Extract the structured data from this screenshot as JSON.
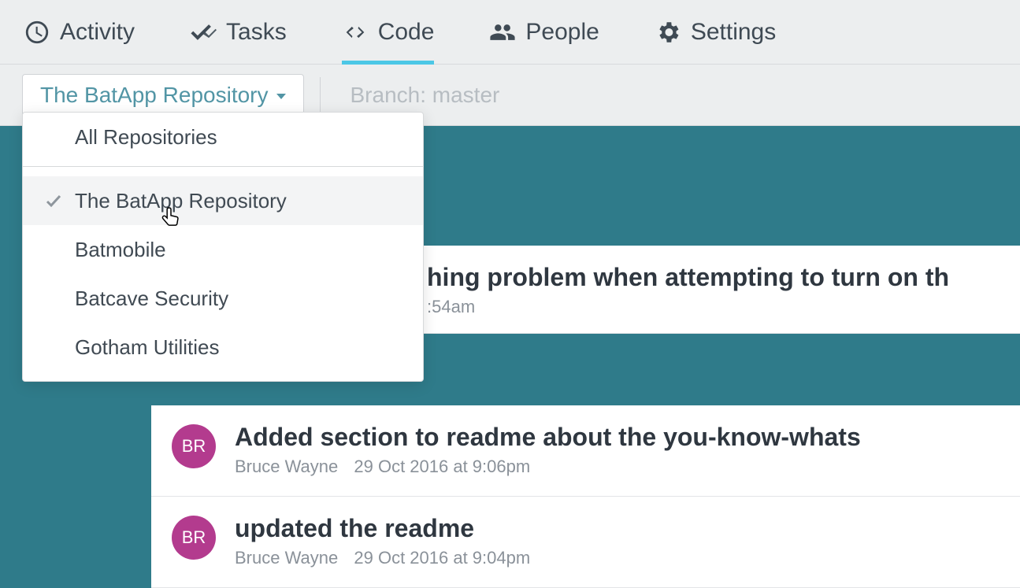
{
  "nav": {
    "activity": "Activity",
    "tasks": "Tasks",
    "code": "Code",
    "people": "People",
    "settings": "Settings",
    "active": "code"
  },
  "filters": {
    "repo_selected": "The BatApp Repository",
    "branch_label": "Branch: master"
  },
  "repo_dropdown": {
    "all_label": "All Repositories",
    "items": [
      {
        "label": "The BatApp Repository",
        "selected": true
      },
      {
        "label": "Batmobile",
        "selected": false
      },
      {
        "label": "Batcave Security",
        "selected": false
      },
      {
        "label": "Gotham Utilities",
        "selected": false
      }
    ]
  },
  "commits": [
    {
      "initials": "",
      "title_fragment": "hing problem when attempting to turn on th",
      "time_fragment": ":54am",
      "author": "",
      "timestamp": ""
    },
    {
      "initials": "BR",
      "title": "Added section to readme about the you-know-whats",
      "author": "Bruce Wayne",
      "timestamp": "29 Oct 2016 at 9:06pm"
    },
    {
      "initials": "BR",
      "title": "updated the readme",
      "author": "Bruce Wayne",
      "timestamp": "29 Oct 2016 at 9:04pm"
    }
  ],
  "colors": {
    "accent": "#4cc7e6",
    "teal_bg": "#2f7b8a",
    "avatar": "#b33b8e"
  }
}
